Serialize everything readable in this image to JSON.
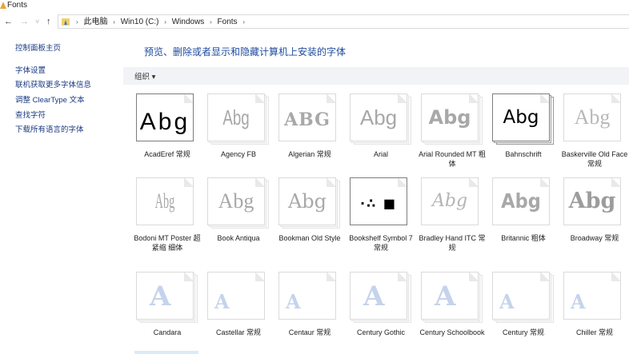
{
  "window": {
    "title": "Fonts"
  },
  "nav": {
    "back": "←",
    "forward": "→",
    "recent": "˅",
    "up": "↑"
  },
  "address": {
    "crumbs": [
      "此电脑",
      "Win10 (C:)",
      "Windows",
      "Fonts"
    ],
    "separator": "›"
  },
  "sidebar": {
    "items": [
      "控制面板主页",
      "字体设置",
      "联机获取更多字体信息",
      "调整 ClearType 文本",
      "查找字符",
      "下载所有语言的字体"
    ]
  },
  "main": {
    "heading": "预览、删除或者显示和隐藏计算机上安装的字体",
    "organize": "组织 ▾"
  },
  "fonts": [
    {
      "name": "AcadEref 常规",
      "sample": "Abg"
    },
    {
      "name": "Agency FB",
      "sample": "Abg"
    },
    {
      "name": "Algerian 常规",
      "sample": "ABG"
    },
    {
      "name": "Arial",
      "sample": "Abg"
    },
    {
      "name": "Arial Rounded MT 粗体",
      "sample": "Abg"
    },
    {
      "name": "Bahnschrift",
      "sample": "Abg"
    },
    {
      "name": "Baskerville Old Face 常规",
      "sample": "Abg"
    },
    {
      "name": "Bodoni MT Poster 超紧缩 细体",
      "sample": "Abg"
    },
    {
      "name": "Book Antiqua",
      "sample": "Abg"
    },
    {
      "name": "Bookman Old Style",
      "sample": "Abg"
    },
    {
      "name": "Bookshelf Symbol 7 常规",
      "sample": "·∴ ■"
    },
    {
      "name": "Bradley Hand ITC 常规",
      "sample": "Abg"
    },
    {
      "name": "Britannic 粗体",
      "sample": "Abg"
    },
    {
      "name": "Broadway 常规",
      "sample": "Abg"
    },
    {
      "name": "Candara",
      "sample": "A"
    },
    {
      "name": "Castellar 常规",
      "sample": "A"
    },
    {
      "name": "Centaur 常规",
      "sample": "A"
    },
    {
      "name": "Century Gothic",
      "sample": "A"
    },
    {
      "name": "Century Schoolbook",
      "sample": "A"
    },
    {
      "name": "Century 常规",
      "sample": "A"
    },
    {
      "name": "Chiller 常规",
      "sample": "A"
    }
  ],
  "colors": {
    "link": "#1a3a80",
    "heading": "#1e4b9e",
    "cmdbar": "#f1f3f6"
  }
}
